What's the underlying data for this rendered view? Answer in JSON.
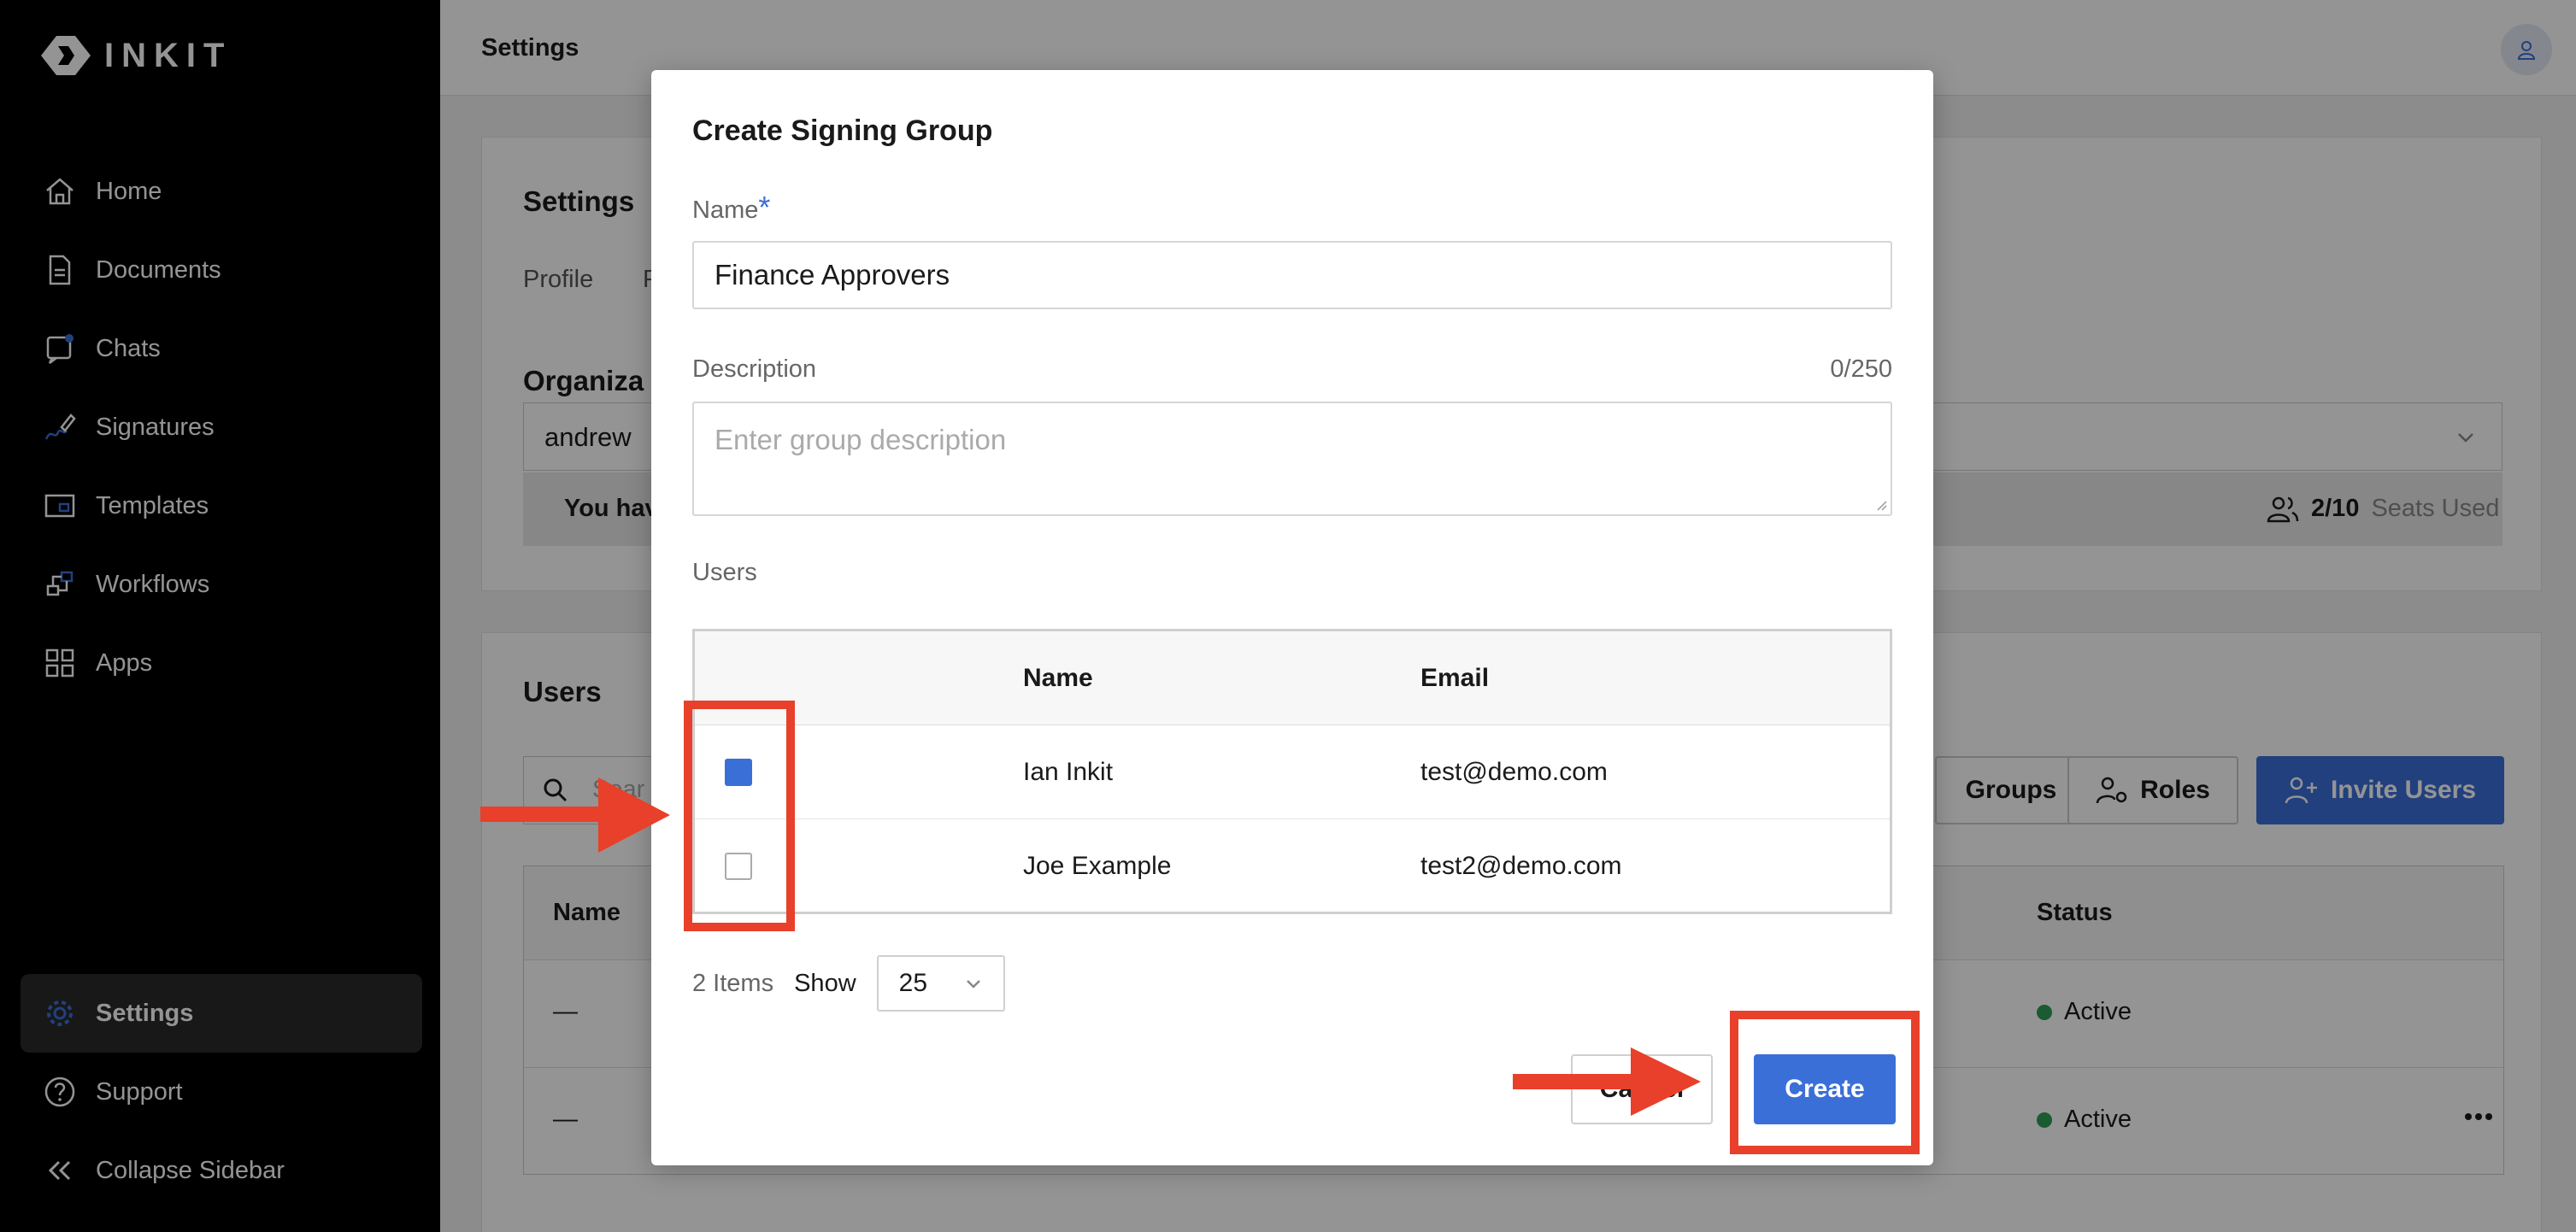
{
  "brand": {
    "name": "INKIT"
  },
  "sidebar": {
    "items": [
      {
        "label": "Home",
        "icon": "home-icon"
      },
      {
        "label": "Documents",
        "icon": "document-icon"
      },
      {
        "label": "Chats",
        "icon": "chat-icon"
      },
      {
        "label": "Signatures",
        "icon": "signature-icon"
      },
      {
        "label": "Templates",
        "icon": "template-icon"
      },
      {
        "label": "Workflows",
        "icon": "workflow-icon"
      },
      {
        "label": "Apps",
        "icon": "apps-icon"
      }
    ],
    "settings_label": "Settings",
    "support_label": "Support",
    "collapse_label": "Collapse Sidebar"
  },
  "header": {
    "title": "Settings"
  },
  "background": {
    "settings_heading": "Settings",
    "tab_profile": "Profile",
    "tab_partial": "P",
    "org_heading": "Organiza",
    "org_value": "andrew",
    "banner_text": "You hav",
    "seats_count": "2/10",
    "seats_label": "Seats Used",
    "users_heading": "Users",
    "search_placeholder": "Sear",
    "groups_button": "Groups",
    "roles_button": "Roles",
    "invite_button": "Invite Users",
    "col_name": "Name",
    "col_status": "Status",
    "row1_name": "—",
    "row2_name": "—",
    "status_active": "Active"
  },
  "modal": {
    "title": "Create Signing Group",
    "name_label": "Name",
    "required_mark": "*",
    "name_value": "Finance Approvers",
    "description_label": "Description",
    "description_counter": "0/250",
    "description_placeholder": "Enter group description",
    "users_label": "Users",
    "table": {
      "col_name": "Name",
      "col_email": "Email",
      "rows": [
        {
          "name": "Ian Inkit",
          "email": "test@demo.com",
          "checked": true
        },
        {
          "name": "Joe Example",
          "email": "test2@demo.com",
          "checked": false
        }
      ]
    },
    "items_count": "2 Items",
    "show_label": "Show",
    "page_size": "25",
    "cancel_label": "Cancel",
    "create_label": "Create"
  },
  "colors": {
    "accent": "#3b6fd8",
    "annotation": "#e8402a",
    "sidebar": "#000000",
    "active": "#2e9e56"
  }
}
